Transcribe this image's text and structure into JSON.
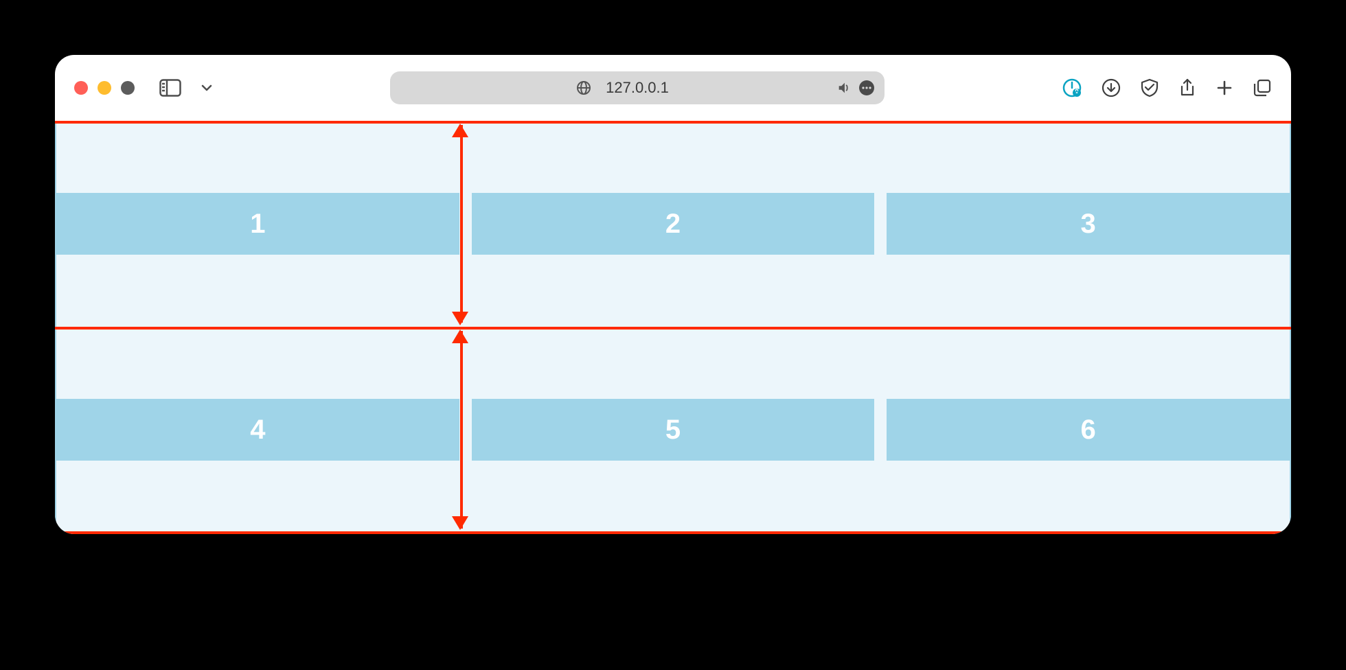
{
  "browser": {
    "address": "127.0.0.1"
  },
  "grid": {
    "rows": [
      {
        "cells": [
          "1",
          "2",
          "3"
        ]
      },
      {
        "cells": [
          "4",
          "5",
          "6"
        ]
      }
    ]
  },
  "annotation": {
    "description": "Two stacked red horizontal measurement brackets with inward-pointing arrows, each spanning one grid row height, with a shared midline. Vertical arrow line positioned at approximately x≈33% (between column 1 and column 2).",
    "color": "#ff2a00"
  }
}
